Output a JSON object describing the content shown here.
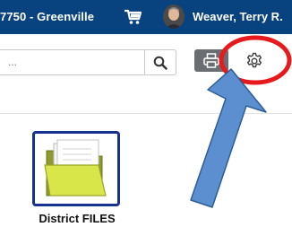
{
  "header": {
    "location_text": "7750 - Greenville",
    "cart_icon": "cart-icon",
    "user_name": "Weaver, Terry R."
  },
  "search": {
    "placeholder": "...",
    "search_icon": "search-icon"
  },
  "toolbar": {
    "print_icon": "printer-icon",
    "settings_icon": "gear-icon"
  },
  "tiles": [
    {
      "label": "District FILES",
      "icon": "folder-icon"
    }
  ],
  "annotation": {
    "circle_color": "#e8191c",
    "arrow_color": "#5b8fd0"
  },
  "colors": {
    "header_bg": "#08437f",
    "tile_border": "#16318f",
    "print_button": "#6a6e73"
  }
}
